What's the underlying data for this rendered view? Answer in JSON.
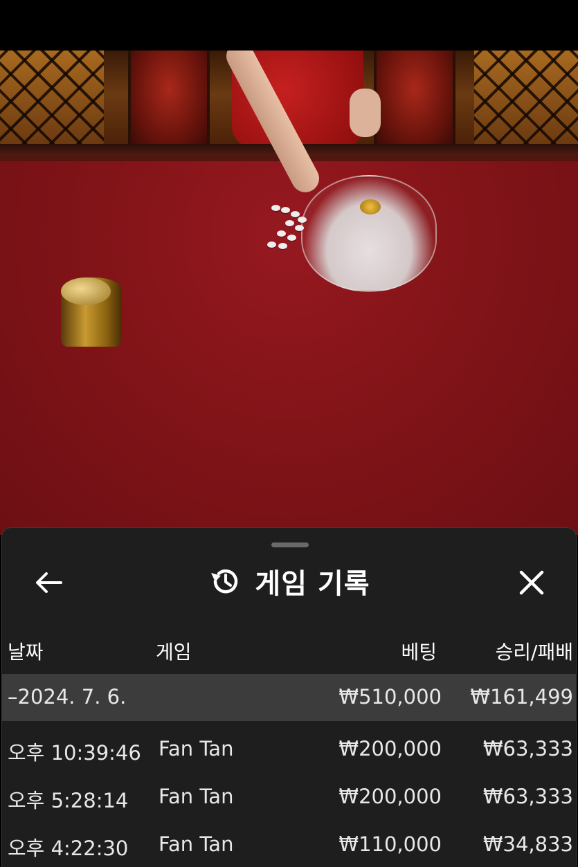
{
  "history_panel": {
    "title": "게임 기록",
    "columns": {
      "date": "날짜",
      "game": "게임",
      "bet": "베팅",
      "result": "승리/패배"
    },
    "summary": {
      "date": "–2024. 7. 6.",
      "bet": "₩510,000",
      "result": "₩161,499"
    },
    "rows": [
      {
        "time": "오후 10:39:46",
        "game": "Fan Tan",
        "bet": "₩200,000",
        "result": "₩63,333"
      },
      {
        "time": "오후 5:28:14",
        "game": "Fan Tan",
        "bet": "₩200,000",
        "result": "₩63,333"
      },
      {
        "time": "오후 4:22:30",
        "game": "Fan Tan",
        "bet": "₩110,000",
        "result": "₩34,833"
      }
    ]
  },
  "icons": {
    "back": "arrow-left-icon",
    "history": "history-icon",
    "close": "close-icon"
  },
  "colors": {
    "panel_bg": "#1e1e1e",
    "summary_row_bg": "#3c3c3c",
    "text": "#ffffff",
    "felt": "#8a1418"
  }
}
